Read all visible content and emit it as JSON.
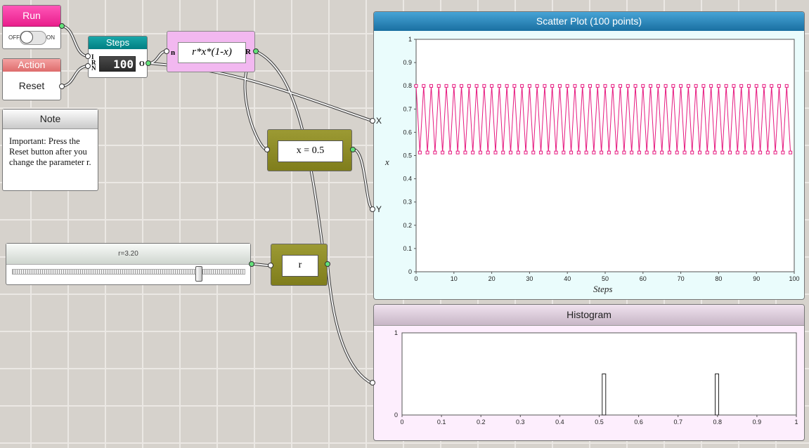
{
  "run": {
    "title": "Run",
    "toggle_off": "OFF",
    "toggle_on": "ON"
  },
  "action": {
    "title": "Action",
    "button": "Reset"
  },
  "note": {
    "title": "Note",
    "text": "Important: Press the Reset button after you change the parameter r."
  },
  "steps": {
    "title": "Steps",
    "value": "100",
    "port_i": "I",
    "port_r": "R",
    "port_n": "N",
    "port_o": "O"
  },
  "formula": {
    "expression": "r*x*(1-x)",
    "port_n": "n",
    "port_r": "R"
  },
  "initial_x": {
    "label": "x = 0.5"
  },
  "slider": {
    "label": "r=3.20",
    "value": 3.2,
    "min": 0,
    "max": 4
  },
  "r_node": {
    "label": "r"
  },
  "scatter": {
    "title": "Scatter Plot (100 points)",
    "port_x": "X",
    "port_y": "Y",
    "xlabel": "Steps",
    "ylabel": "x",
    "series_color": "#e6197f"
  },
  "histogram": {
    "title": "Histogram"
  },
  "chart_data": [
    {
      "type": "scatter",
      "title": "Scatter Plot (100 points)",
      "xlabel": "Steps",
      "ylabel": "x",
      "xlim": [
        0,
        100
      ],
      "ylim": [
        0,
        1
      ],
      "xticks": [
        "0",
        "10",
        "20",
        "30",
        "40",
        "50",
        "60",
        "70",
        "80",
        "90",
        "100"
      ],
      "yticks": [
        "0",
        "0.1",
        "0.2",
        "0.3",
        "0.4",
        "0.5",
        "0.6",
        "0.7",
        "0.8",
        "0.9",
        "1"
      ],
      "series": [
        {
          "start_x": 0,
          "step": 1,
          "count": 100,
          "y_pattern": [
            0.7995,
            0.513
          ]
        }
      ]
    },
    {
      "type": "bar",
      "title": "Histogram",
      "xlim": [
        0,
        1
      ],
      "ylim": [
        0,
        1
      ],
      "xticks": [
        "0",
        "0.1",
        "0.2",
        "0.3",
        "0.4",
        "0.5",
        "0.6",
        "0.7",
        "0.8",
        "0.9",
        "1"
      ],
      "yticks": [
        "0",
        "1"
      ],
      "bars": [
        {
          "x": 0.513,
          "value": 0.5
        },
        {
          "x": 0.7995,
          "value": 0.5
        }
      ]
    }
  ]
}
